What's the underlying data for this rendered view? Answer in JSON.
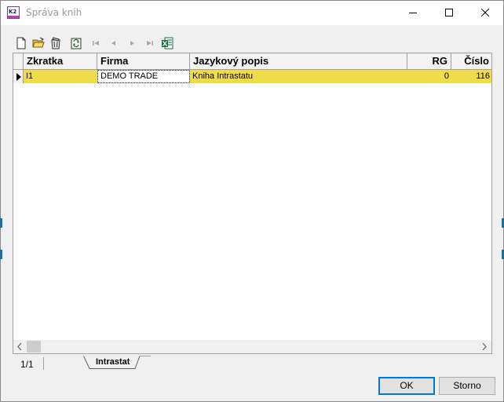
{
  "window": {
    "title": "Správa knih",
    "icon_label": "K2"
  },
  "toolbar": {
    "buttons": [
      {
        "name": "new",
        "icon": "new-document-icon"
      },
      {
        "name": "open",
        "icon": "open-folder-icon"
      },
      {
        "name": "delete",
        "icon": "trash-icon"
      },
      {
        "name": "refresh",
        "icon": "refresh-icon"
      },
      {
        "name": "first",
        "icon": "first-record-icon"
      },
      {
        "name": "prev",
        "icon": "previous-record-icon"
      },
      {
        "name": "next",
        "icon": "next-record-icon"
      },
      {
        "name": "last",
        "icon": "last-record-icon"
      },
      {
        "name": "excel",
        "icon": "excel-export-icon"
      }
    ]
  },
  "grid": {
    "columns": [
      "Zkratka",
      "Firma",
      "Jazykový popis",
      "RG",
      "Číslo"
    ],
    "rows": [
      {
        "zkratka": "I1",
        "firma": "DEMO TRADE",
        "popis": "Kniha Intrastatu",
        "rg": "0",
        "cislo": "116"
      }
    ],
    "row_highlight_color": "#f0dc4a"
  },
  "status": {
    "record_count": "1/1",
    "tab_label": "Intrastat"
  },
  "buttons": {
    "ok": "OK",
    "cancel": "Storno"
  },
  "colors": {
    "accent": "#0078d7",
    "selection": "#f0dc4a"
  }
}
